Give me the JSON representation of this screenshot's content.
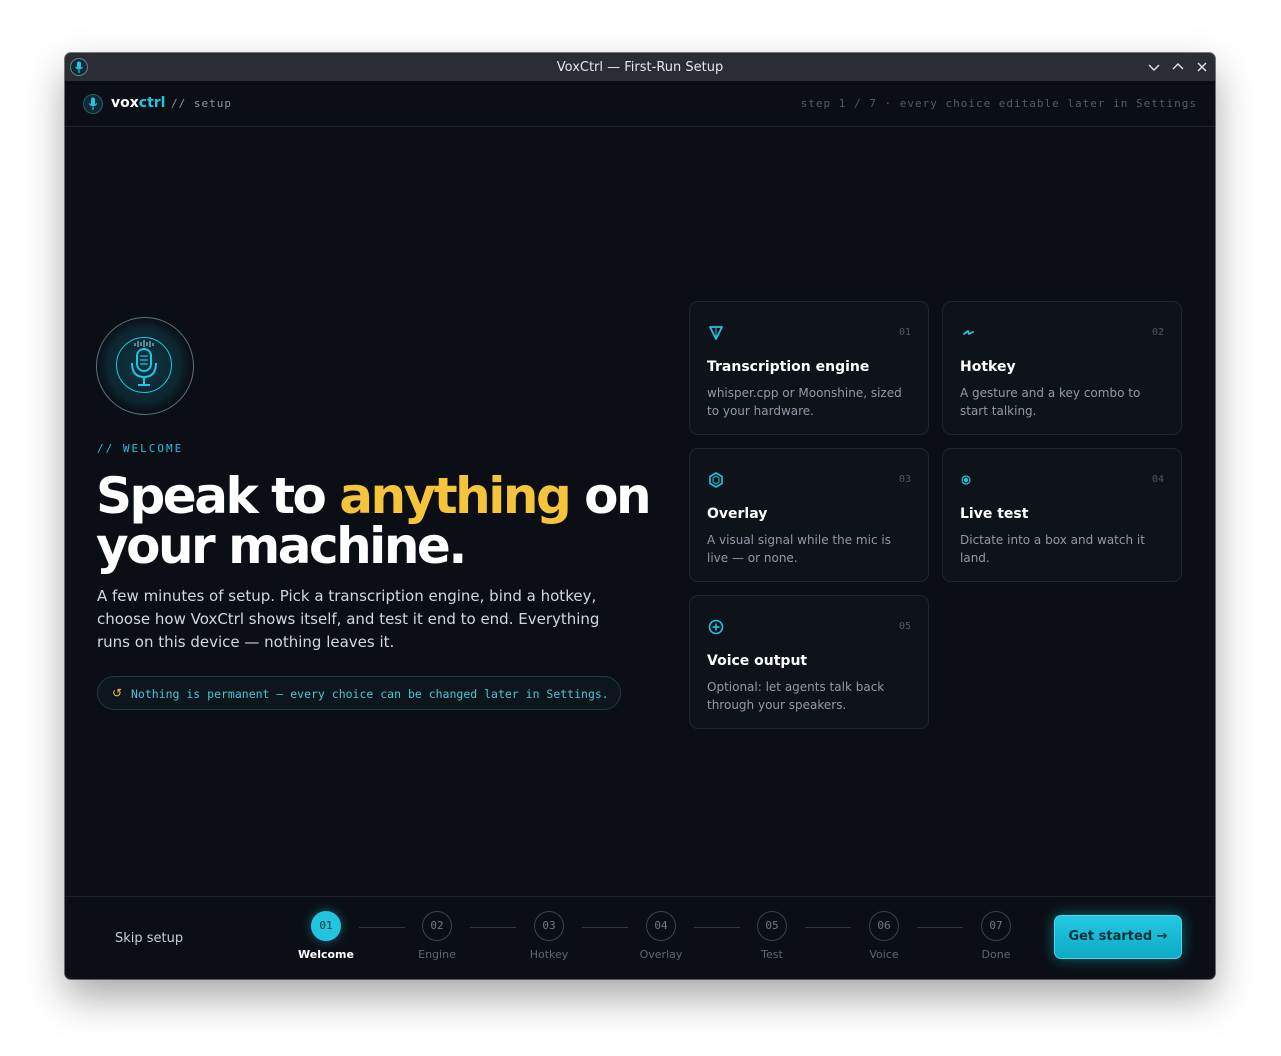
{
  "window": {
    "title": "VoxCtrl — First-Run Setup",
    "controls": [
      "chevron-down-icon",
      "chevron-up-icon",
      "close-icon"
    ]
  },
  "header": {
    "brand_prefix": "vox",
    "brand_suffix": "ctrl",
    "crumb": "// setup",
    "step_note": "step 1 / 7 · every choice editable later in Settings"
  },
  "hero": {
    "eyebrow": "// WELCOME",
    "headline_a": "Speak to ",
    "headline_highlight": "anything",
    "headline_b": " on your machine.",
    "lead": "A few minutes of setup. Pick a transcription engine, bind a hotkey, choose how VoxCtrl shows itself, and test it end to end. Everything runs on this device — nothing leaves it.",
    "note_icon": "↺",
    "note": "Nothing is permanent — every choice can be changed later in Settings."
  },
  "cards": [
    {
      "num": "01",
      "title": "Transcription engine",
      "desc": "whisper.cpp or Moonshine, sized to your hardware.",
      "icon": "funnel-icon"
    },
    {
      "num": "02",
      "title": "Hotkey",
      "desc": "A gesture and a key combo to start talking.",
      "icon": "bolt-icon"
    },
    {
      "num": "03",
      "title": "Overlay",
      "desc": "A visual signal while the mic is live — or none.",
      "icon": "hexagon-icon"
    },
    {
      "num": "04",
      "title": "Live test",
      "desc": "Dictate into a box and watch it land.",
      "icon": "target-dot-icon"
    },
    {
      "num": "05",
      "title": "Voice output",
      "desc": "Optional: let agents talk back through your speakers.",
      "icon": "plus-circle-icon"
    }
  ],
  "footer": {
    "skip": "Skip setup",
    "cta": "Get started →",
    "steps": [
      {
        "num": "01",
        "label": "Welcome",
        "active": true
      },
      {
        "num": "02",
        "label": "Engine"
      },
      {
        "num": "03",
        "label": "Hotkey"
      },
      {
        "num": "04",
        "label": "Overlay"
      },
      {
        "num": "05",
        "label": "Test"
      },
      {
        "num": "06",
        "label": "Voice"
      },
      {
        "num": "07",
        "label": "Done"
      }
    ]
  },
  "colors": {
    "accent": "#22c5e0",
    "highlight": "#f5c43c",
    "background": "#0b0f15"
  }
}
